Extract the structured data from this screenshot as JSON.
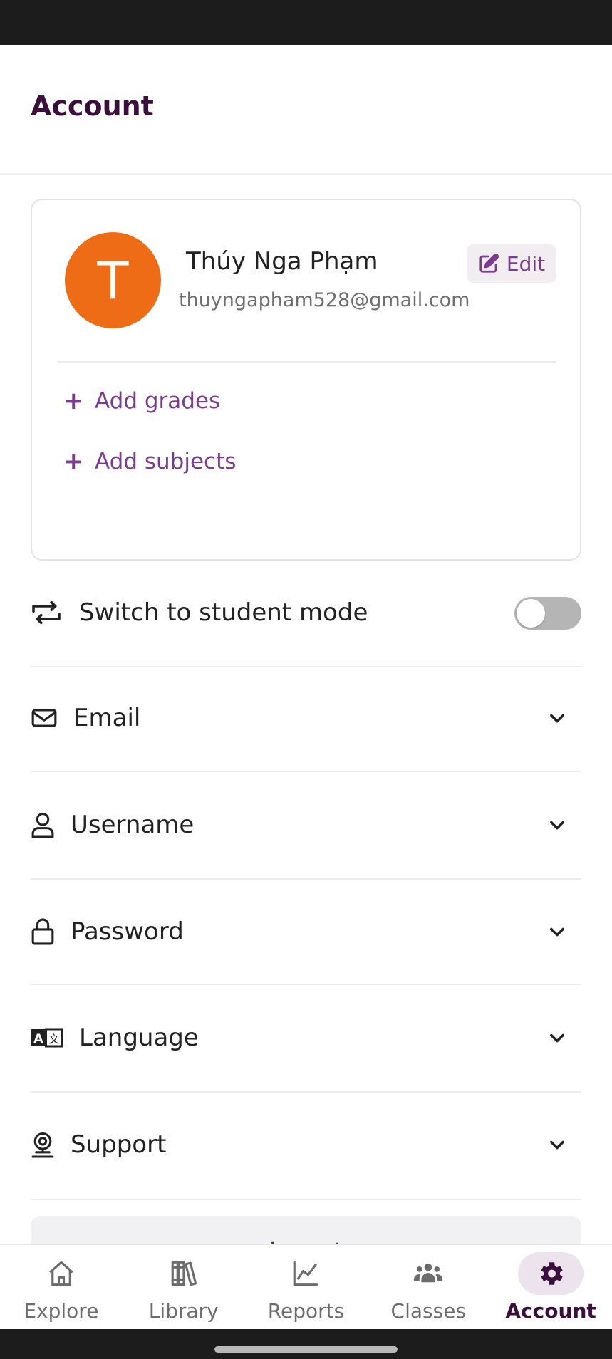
{
  "header": {
    "title": "Account"
  },
  "profile": {
    "avatar_letter": "T",
    "name": "Thúy Nga Phạm",
    "email": "thuyngapham528@gmail.com",
    "edit_label": "Edit",
    "add_grades_label": "Add grades",
    "add_subjects_label": "Add subjects",
    "avatar_color": "#ef6c17"
  },
  "student_mode": {
    "label": "Switch to student mode",
    "enabled": false
  },
  "sections": {
    "email": "Email",
    "username": "Username",
    "password": "Password",
    "language": "Language",
    "support": "Support"
  },
  "logout": {
    "label": "Logout"
  },
  "nav": {
    "explore": "Explore",
    "library": "Library",
    "reports": "Reports",
    "classes": "Classes",
    "account": "Account",
    "active": "account"
  },
  "colors": {
    "accent": "#7a3c8f",
    "title": "#3b0f3b"
  }
}
